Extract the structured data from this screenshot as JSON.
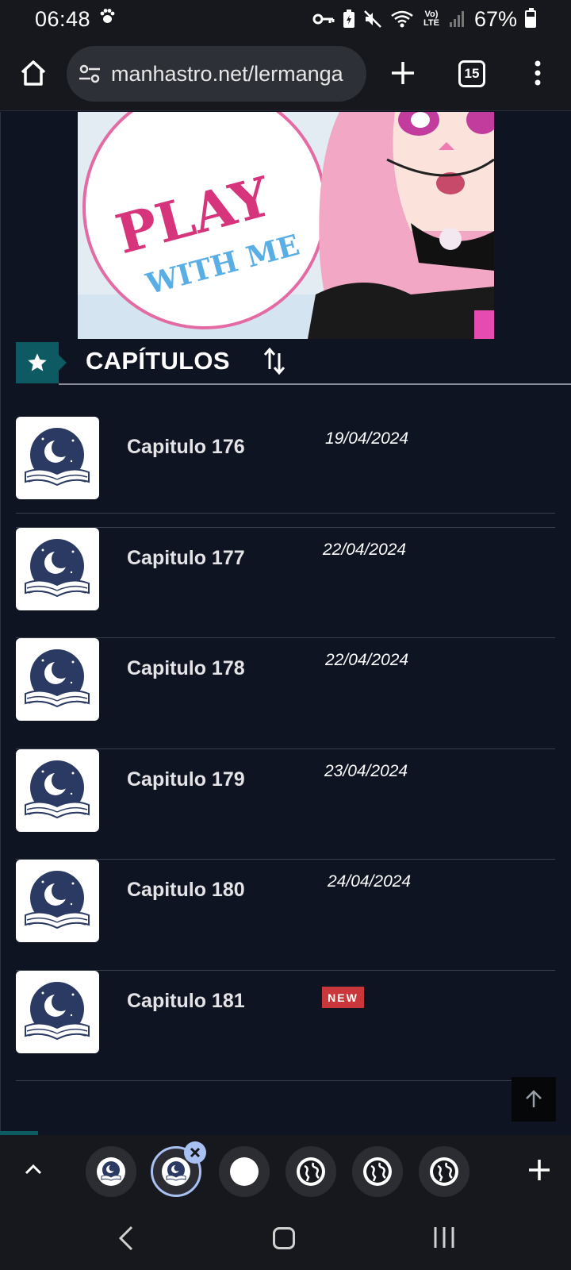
{
  "status_bar": {
    "time": "06:48",
    "battery_percent": "67%",
    "icons": [
      "paw-icon",
      "key-icon",
      "battery-saver-icon",
      "mute-icon",
      "wifi-icon",
      "volte-icon",
      "signal-icon",
      "battery-icon"
    ],
    "volte_label": "Vo) LTE"
  },
  "browser": {
    "url": "manhastro.net/lermanga",
    "tab_count": "15"
  },
  "cover": {
    "headline": "PLAY",
    "subline": "WITH ME"
  },
  "section": {
    "title": "CAPÍTULOS"
  },
  "chapters": [
    {
      "title": "Capitulo 176",
      "date": "19/04/2024"
    },
    {
      "title": "Capitulo 177",
      "date": "22/04/2024"
    },
    {
      "title": "Capitulo 178",
      "date": "22/04/2024"
    },
    {
      "title": "Capitulo 179",
      "date": "23/04/2024"
    },
    {
      "title": "Capitulo 180",
      "date": "24/04/2024"
    },
    {
      "title": "Capitulo 181",
      "badge": "NEW"
    }
  ],
  "colors": {
    "page_bg": "#0f1423",
    "accent_teal": "#0d5a63",
    "new_badge": "#c9373a",
    "active_tab_ring": "#a8c1f2"
  }
}
